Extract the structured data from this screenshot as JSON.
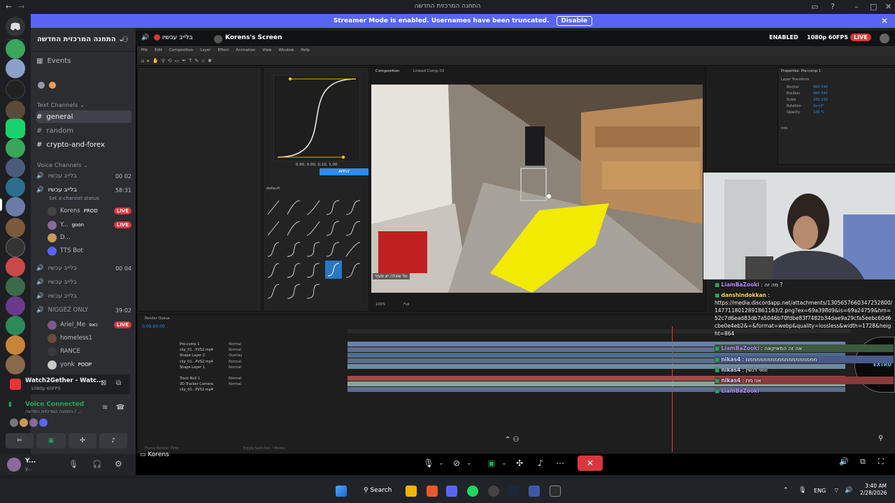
{
  "window": {
    "title": "התחנה המרכזית החדשה"
  },
  "banner": {
    "text": "Streamer Mode is enabled. Usernames have been truncated.",
    "disable_label": "Disable"
  },
  "server": {
    "name": "התחנה המרכזית החדשה"
  },
  "sidebar": {
    "events_label": "Events",
    "text_category": "Text Channels",
    "text_channels": [
      "general",
      "random",
      "crypto-and-forex"
    ],
    "voice_category": "Voice Channels",
    "voice_channels": [
      {
        "name": "בלייב עכשיו",
        "time": "00 02"
      },
      {
        "name": "בלייב עכשיו",
        "time": "58:31"
      }
    ],
    "set_status": "Set a channel status",
    "voice_users": [
      {
        "name": "Korens",
        "tag": "PROD",
        "live": "LIVE"
      },
      {
        "name": "Y...",
        "tag": "goon",
        "live": "LIVE"
      },
      {
        "name": "D..."
      },
      {
        "name": "TTS Bot"
      }
    ],
    "more_voice": [
      {
        "name": "בלייב עכשיו",
        "time": "00 04"
      },
      {
        "name": "בלייב עכשיו"
      },
      {
        "name": "בלייב עכשיו"
      },
      {
        "name": "NIGGEZ ONLY",
        "time": "39:02"
      }
    ],
    "niggez_users": [
      {
        "name": "Ariel_Me",
        "tag": "כאפ",
        "live": "LIVE"
      },
      {
        "name": "homeless1"
      },
      {
        "name": "RANCE"
      },
      {
        "name": "yonk",
        "tag": "POOP"
      }
    ]
  },
  "activity": {
    "title": "Watch2Gether - Watc...",
    "sub": "1080p 60FPS"
  },
  "voice": {
    "status": "Voice Connected",
    "sub": "התחנה המרכזית החדשה / ..."
  },
  "user": {
    "name": "Y...",
    "sub": "y..."
  },
  "stream": {
    "header_user": "בלייב עכשיו",
    "screen_label": "Korens's Screen",
    "enabled_label": "ENABLED",
    "quality": "1080p 60FPS",
    "live": "LIVE",
    "bottom_user": "Korens"
  },
  "aftereffects": {
    "menu": [
      "File",
      "Edit",
      "Composition",
      "Layer",
      "Effect",
      "Animation",
      "View",
      "Window",
      "Help"
    ],
    "ease_values": "0.90, 0.00, 0.10, 1.00",
    "apply_label": "APPLY",
    "preset_label": "default",
    "comp_tab": "Composition",
    "comp_name": "Linked Comp 02",
    "zoom": "100%",
    "quality": "Full",
    "timecode": "0:00:00:00",
    "caption": "על שאלה יא סעיף",
    "layers": [
      "Pre-comp 1",
      "clip_01...PVS2.mp4",
      "Shape Layer 2",
      "clip_01...PVS2.mp4",
      "Shape Layer 1",
      "Track Null 1",
      "3D Tracker Camera",
      "clip_01...PVS2.mp4"
    ],
    "modes": [
      "Normal",
      "Normal",
      "Overlay",
      "Normal",
      "Normal",
      "Normal",
      "",
      "Normal"
    ],
    "properties_title": "Properties: Pre-comp 1",
    "layer_transform": "Layer Transform",
    "props": [
      "Anchor",
      "Position",
      "Scale",
      "Rotation",
      "Opacity"
    ],
    "prop_vals": [
      "960 540",
      "960 540",
      "100 100",
      "0x+0°",
      "100 %"
    ],
    "info_label": "Info",
    "render_queue": "Render Queue",
    "frame_render": "Frame Render Time",
    "toggle": "Toggle Switches / Modes"
  },
  "chat": [
    {
      "user": "LiamBaZooki",
      "text": "מה זה ?",
      "color": "#b78cff"
    },
    {
      "user": "danshindokkan",
      "text": "https://media.discordapp.net/attachments/1305657660347252800/1477118012891861163/2.png?ex=69a398d9&is=69a24759&hm=52c7d6ead83db7a5046b70fdbe83f7482b34dae9a29cfa5eebc60d6cbe0e4eb2&=&format=webp&quality=lossless&width=1728&height=864",
      "color": "#ffd95a"
    },
    {
      "user": "LiamBaZooki",
      "text": "אה זה המאיקאה",
      "color": "#b78cff"
    },
    {
      "user": "nikas4",
      "text": "ממממממממממממממממממממ",
      "color": "#cfd3ff"
    },
    {
      "user": "nikas4",
      "text": "ווואי דנשין",
      "color": "#cfd3ff"
    },
    {
      "user": "nikas4",
      "text": "אני מת",
      "color": "#cfd3ff"
    },
    {
      "user": "LiamBaZooki",
      "text": "",
      "color": "#b78cff"
    }
  ],
  "side_overlay": "EXTRU",
  "taskbar": {
    "search": "Search",
    "lang": "ENG",
    "time": "3:40 AM",
    "date": "2/28/2026"
  },
  "colors": {
    "blurple": "#5865f2",
    "live": "#da373c",
    "ae_blue": "#2d8ceb",
    "yellow_path": "#f2ea00"
  }
}
